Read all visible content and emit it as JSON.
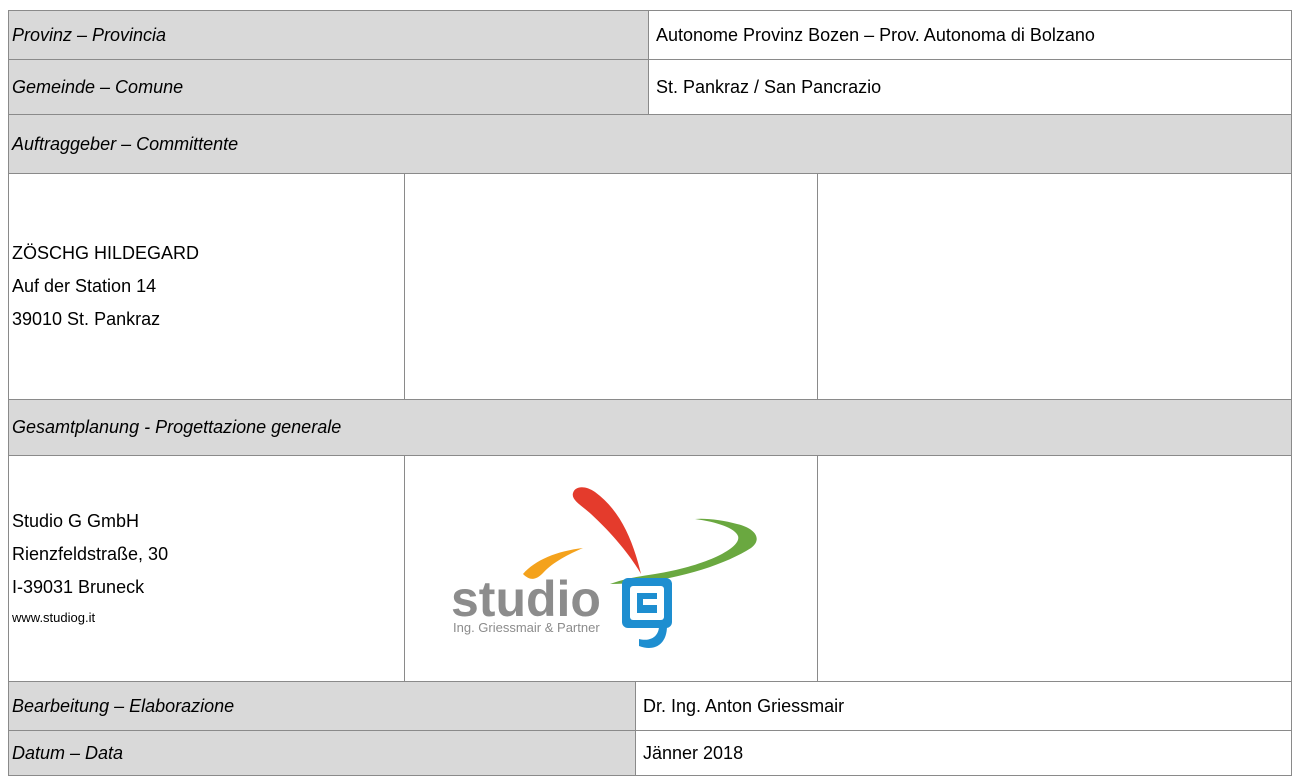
{
  "rows": {
    "province": {
      "label": "Provinz – Provincia",
      "value": "Autonome Provinz Bozen – Prov. Autonoma di Bolzano"
    },
    "municipality": {
      "label": "Gemeinde – Comune",
      "value": "St. Pankraz / San Pancrazio"
    },
    "client": {
      "header": "Auftraggeber – Committente",
      "lines": [
        "ZÖSCHG HILDEGARD",
        "Auf der Station 14",
        "39010 St. Pankraz"
      ]
    },
    "planning": {
      "header": "Gesamtplanung - Progettazione generale",
      "lines": [
        "Studio G GmbH",
        "Rienzfeldstraße, 30",
        "I-39031 Bruneck"
      ],
      "website": "www.studiog.it",
      "logo": {
        "word": "studio",
        "letter": "G",
        "tagline": "Ing. Griessmair & Partner",
        "colors": {
          "grey": "#8c8c8c",
          "blue": "#1e8ed0",
          "red": "#e43b2c",
          "green": "#6aa840",
          "orange": "#f4a21c"
        }
      }
    },
    "processing": {
      "label": "Bearbeitung – Elaborazione",
      "value": "Dr. Ing. Anton Griessmair"
    },
    "date": {
      "label": "Datum – Data",
      "value": "Jänner 2018"
    }
  }
}
